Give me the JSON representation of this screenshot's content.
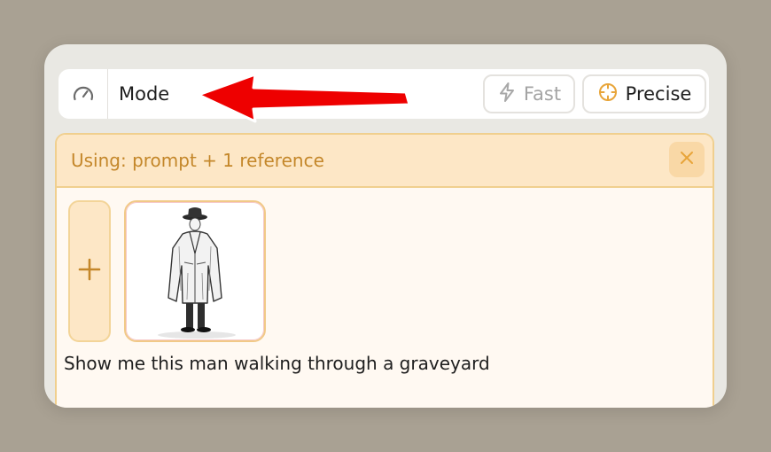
{
  "mode_bar": {
    "icon": "gauge-icon",
    "label": "Mode",
    "options": [
      {
        "label": "Fast",
        "icon": "lightning-icon",
        "state": "disabled"
      },
      {
        "label": "Precise",
        "icon": "crosshair-icon",
        "state": "selected"
      }
    ]
  },
  "reference_panel": {
    "title": "Using: prompt + 1 reference",
    "close_icon": "close-icon",
    "add_icon": "plus-icon",
    "reference_image": "man-in-trench-coat-sketch",
    "prompt": "Show me this man walking through a graveyard"
  },
  "annotation": {
    "arrow_color": "#ee0000"
  },
  "colors": {
    "accent": "#e8a53a",
    "panel_header_bg": "#fde7c6",
    "panel_text": "#c4872a"
  }
}
